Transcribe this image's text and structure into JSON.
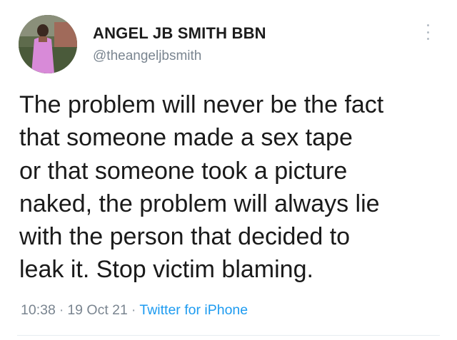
{
  "user": {
    "display_name": "ANGEL JB SMITH BBN",
    "handle": "@theangeljbsmith",
    "avatar_icon": "profile-photo"
  },
  "tweet": {
    "lines": [
      "The problem will never be the fact",
      "that someone made a sex tape",
      "or that someone took a picture",
      "naked, the problem will always lie",
      "with the person that decided to",
      "leak it. Stop victim blaming."
    ],
    "time": "10:38",
    "date": "19 Oct 21",
    "separator": "·",
    "source": "Twitter for iPhone"
  },
  "colors": {
    "link": "#1d9bf0",
    "secondary_text": "#7a8590",
    "primary_text": "#1a1a1a"
  },
  "icons": {
    "more": "more-options-icon"
  }
}
